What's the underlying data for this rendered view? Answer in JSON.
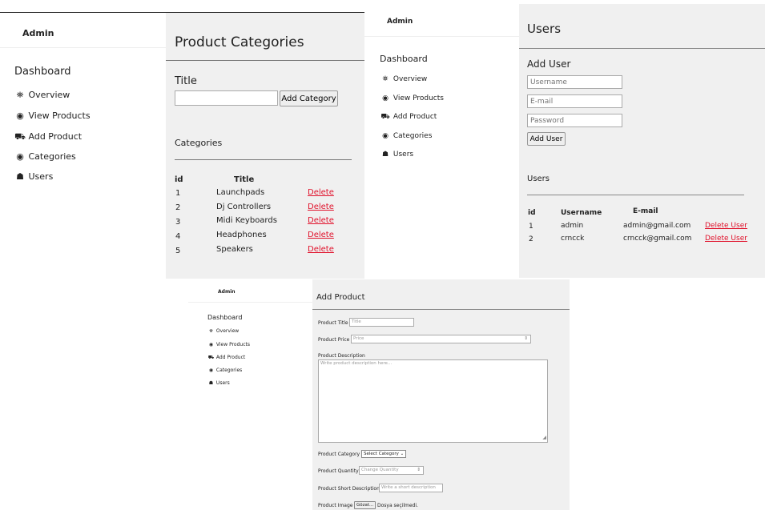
{
  "brand": "Admin",
  "nav": {
    "dashboard": "Dashboard",
    "items": [
      {
        "icon": "binoculars-icon",
        "glyph": "🔭",
        "label": "Overview"
      },
      {
        "icon": "eye-icon",
        "glyph": "◉",
        "label": "View Products"
      },
      {
        "icon": "cart-icon",
        "glyph": "🛒",
        "label": "Add Product"
      },
      {
        "icon": "dot-circle-icon",
        "glyph": "◉",
        "label": "Categories"
      },
      {
        "icon": "users-icon",
        "glyph": "👥",
        "label": "Users"
      }
    ]
  },
  "categories_page": {
    "title": "Product Categories",
    "field_label": "Title",
    "add_button": "Add Category",
    "list_title": "Categories",
    "columns": [
      "id",
      "Title"
    ],
    "delete_label": "Delete",
    "rows": [
      {
        "id": "1",
        "title": "Launchpads"
      },
      {
        "id": "2",
        "title": "Dj Controllers"
      },
      {
        "id": "3",
        "title": "Midi Keyboards"
      },
      {
        "id": "4",
        "title": "Headphones"
      },
      {
        "id": "5",
        "title": "Speakers"
      }
    ]
  },
  "users_page": {
    "title": "Users",
    "add_title": "Add User",
    "username_placeholder": "Username",
    "email_placeholder": "E-mail",
    "password_placeholder": "Password",
    "add_button": "Add User",
    "list_title": "Users",
    "columns": [
      "id",
      "Username",
      "E-mail"
    ],
    "delete_label": "Delete User",
    "rows": [
      {
        "id": "1",
        "username": "admin",
        "email": "admin@gmail.com"
      },
      {
        "id": "2",
        "username": "crncck",
        "email": "crncck@gmail.com"
      }
    ]
  },
  "add_product_page": {
    "title": "Add Product",
    "product_title_label": "Product Title",
    "product_title_placeholder": "Title",
    "price_label": "Product Price",
    "price_placeholder": "Price",
    "description_label": "Product Description",
    "description_placeholder": "Write product description here...",
    "category_label": "Product Category",
    "category_selected": "Select Category",
    "quantity_label": "Product Quantity",
    "quantity_placeholder": "Change Quantity",
    "short_desc_label": "Product Short Description",
    "short_desc_placeholder": "Write a short description",
    "image_label": "Product Image",
    "browse_button": "Gözat...",
    "no_file": "Dosya seçilmedi."
  },
  "colors": {
    "delete_link": "#e0102a",
    "panel_bg": "#f0f0f0"
  }
}
